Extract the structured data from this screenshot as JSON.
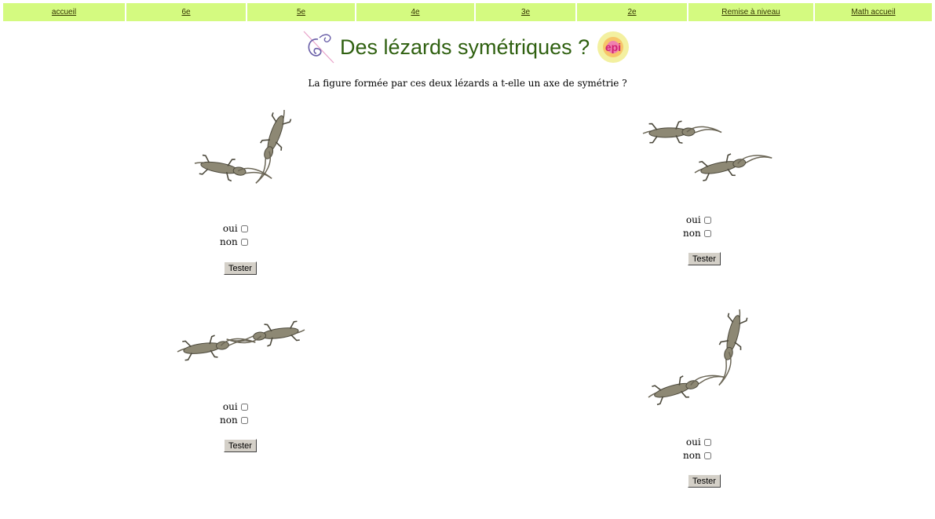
{
  "nav": {
    "items": [
      {
        "label": "accueil"
      },
      {
        "label": "6e"
      },
      {
        "label": "5e"
      },
      {
        "label": "4e"
      },
      {
        "label": "3e"
      },
      {
        "label": "2e"
      },
      {
        "label": "Remise à niveau"
      },
      {
        "label": "Math accueil"
      }
    ],
    "bg": "#d4fa80"
  },
  "header": {
    "title": "Des lézards symétriques ?",
    "logo_text": "epi",
    "title_color": "#2f6010"
  },
  "question": "La figure formée par ces deux lézards a t-elle un axe de symétrie ?",
  "exercises": [
    {
      "oui": "oui",
      "non": "non",
      "button": "Tester"
    },
    {
      "oui": "oui",
      "non": "non",
      "button": "Tester"
    },
    {
      "oui": "oui",
      "non": "non",
      "button": "Tester"
    },
    {
      "oui": "oui",
      "non": "non",
      "button": "Tester"
    }
  ]
}
